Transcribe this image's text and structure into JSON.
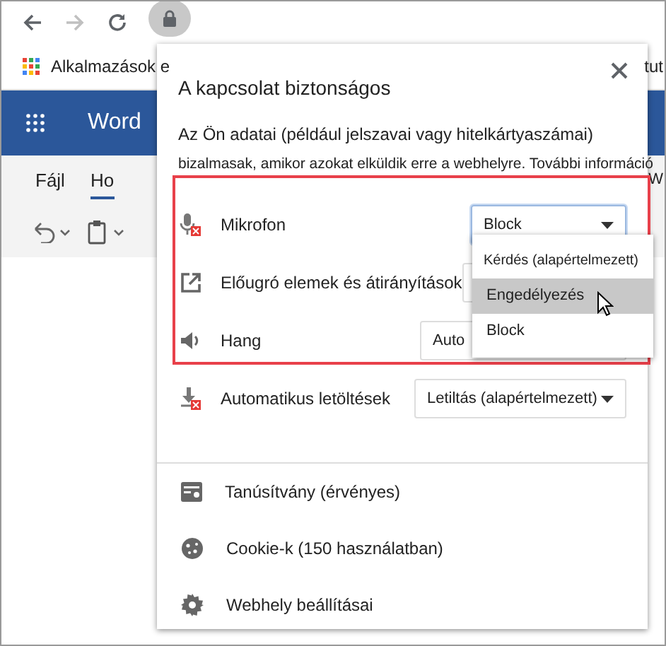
{
  "browser": {
    "bookmarks": [
      {
        "label": "Alkalmazások e"
      },
      {
        "label": "tut"
      }
    ]
  },
  "app": {
    "name": "Word",
    "ribbon_tabs": [
      {
        "label": "Fájl",
        "selected": false
      },
      {
        "label": "Ho",
        "selected": true
      },
      {
        "label": "W",
        "selected": false
      }
    ]
  },
  "popup": {
    "title": "A kapcsolat biztonságos",
    "description": "Az Ön adatai (például jelszavai vagy hitelkártyaszámai)",
    "description_2": "bizalmasak, amikor azokat elküldik erre a webhelyre. ",
    "link": "További információ",
    "permissions": [
      {
        "kind": "microphone",
        "label": "Mikrofon",
        "blocked": true,
        "value": "Block",
        "focused": true
      },
      {
        "kind": "popup",
        "label": "Előugró elemek és átirányítások",
        "blocked": false,
        "focused": false
      },
      {
        "kind": "sound",
        "label": "Hang",
        "blocked": false,
        "value": "Auto",
        "focused": false
      },
      {
        "kind": "download",
        "label": "Automatikus letöltések",
        "blocked": true,
        "value": "Letiltás (alapértelmezett)",
        "focused": false
      }
    ],
    "dropdown_options": [
      {
        "label": "Kérdés (alapértelmezett)",
        "selected": false
      },
      {
        "label": "Engedélyezés",
        "selected": true
      },
      {
        "label": "Block",
        "selected": false
      }
    ],
    "links": [
      {
        "kind": "certificate",
        "label": "Tanúsítvány (érvényes)"
      },
      {
        "kind": "cookie",
        "label": "Cookie-k (150 használatban)"
      },
      {
        "kind": "settings",
        "label": "Webhely beállításai"
      }
    ]
  }
}
